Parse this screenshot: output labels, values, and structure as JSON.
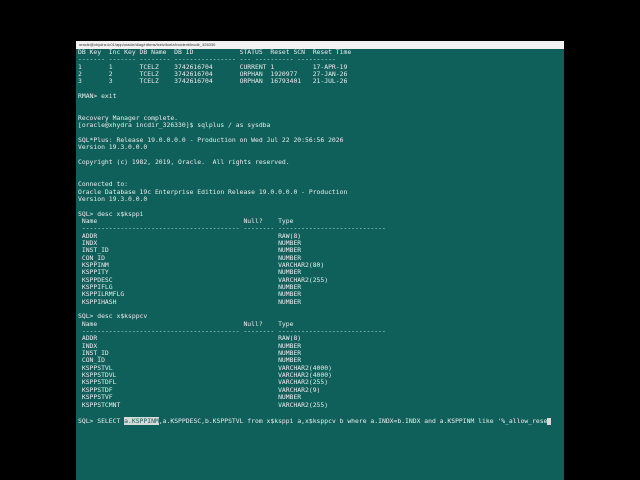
{
  "window": {
    "title": "oracle@xhydra:/u01/app/oracle/diag/rdbms/tcelz/tcelz/incident/incdir_326330"
  },
  "terminal": {
    "lines": [
      "DB Key  Inc Key DB Name  DB ID            STATUS  Reset SCN  Reset Time",
      "------- ------- -------- ---------------- --- ---------- ----------",
      "1       1       TCELZ    3742616704       CURRENT 1          17-APR-19",
      "2       2       TCELZ    3742616704       ORPHAN  1920977    27-JAN-26",
      "3       3       TCELZ    3742616704       ORPHAN  16793401   21-JUL-26",
      "",
      "RMAN> exit",
      "",
      "",
      "Recovery Manager complete.",
      "[oracle@xhydra incdir_326330]$ sqlplus / as sysdba",
      "",
      "SQL*Plus: Release 19.0.0.0.0 - Production on Wed Jul 22 20:56:56 2026",
      "Version 19.3.0.0.0",
      "",
      "Copyright (c) 1982, 2019, Oracle.  All rights reserved.",
      "",
      "",
      "Connected to:",
      "Oracle Database 19c Enterprise Edition Release 19.0.0.0.0 - Production",
      "Version 19.3.0.0.0",
      "",
      "SQL> desc x$ksppi",
      " Name                                      Null?    Type",
      " ----------------------------------------- -------- ----------------------------",
      " ADDR                                               RAW(8)",
      " INDX                                               NUMBER",
      " INST_ID                                            NUMBER",
      " CON_ID                                             NUMBER",
      " KSPPINM                                            VARCHAR2(80)",
      " KSPPITY                                            NUMBER",
      " KSPPDESC                                           VARCHAR2(255)",
      " KSPPIFLG                                           NUMBER",
      " KSPPILRMFLG                                        NUMBER",
      " KSPPIHASH                                          NUMBER",
      "",
      "SQL> desc x$ksppcv",
      " Name                                      Null?    Type",
      " ----------------------------------------- -------- ----------------------------",
      " ADDR                                               RAW(8)",
      " INDX                                               NUMBER",
      " INST_ID                                            NUMBER",
      " CON_ID                                             NUMBER",
      " KSPPSTVL                                           VARCHAR2(4000)",
      " KSPPSTDVL                                          VARCHAR2(4000)",
      " KSPPSTDFL                                          VARCHAR2(255)",
      " KSPPSTDF                                           VARCHAR2(9)",
      " KSPPSTVF                                           NUMBER",
      " KSPPSTCMNT                                         VARCHAR2(255)"
    ],
    "prompt_before": "SQL> SELECT ",
    "selected": "a.KSPPINM",
    "prompt_after": ",a.KSPPDESC,b.KSPPSTVL from x$ksppi a,x$ksppcv b where a.INDX=b.INDX and a.KSPPINM like '%_allow_rese"
  },
  "colors": {
    "background": "#0f5f5a",
    "text": "#ececec",
    "highlight": "#d9d9d9"
  }
}
